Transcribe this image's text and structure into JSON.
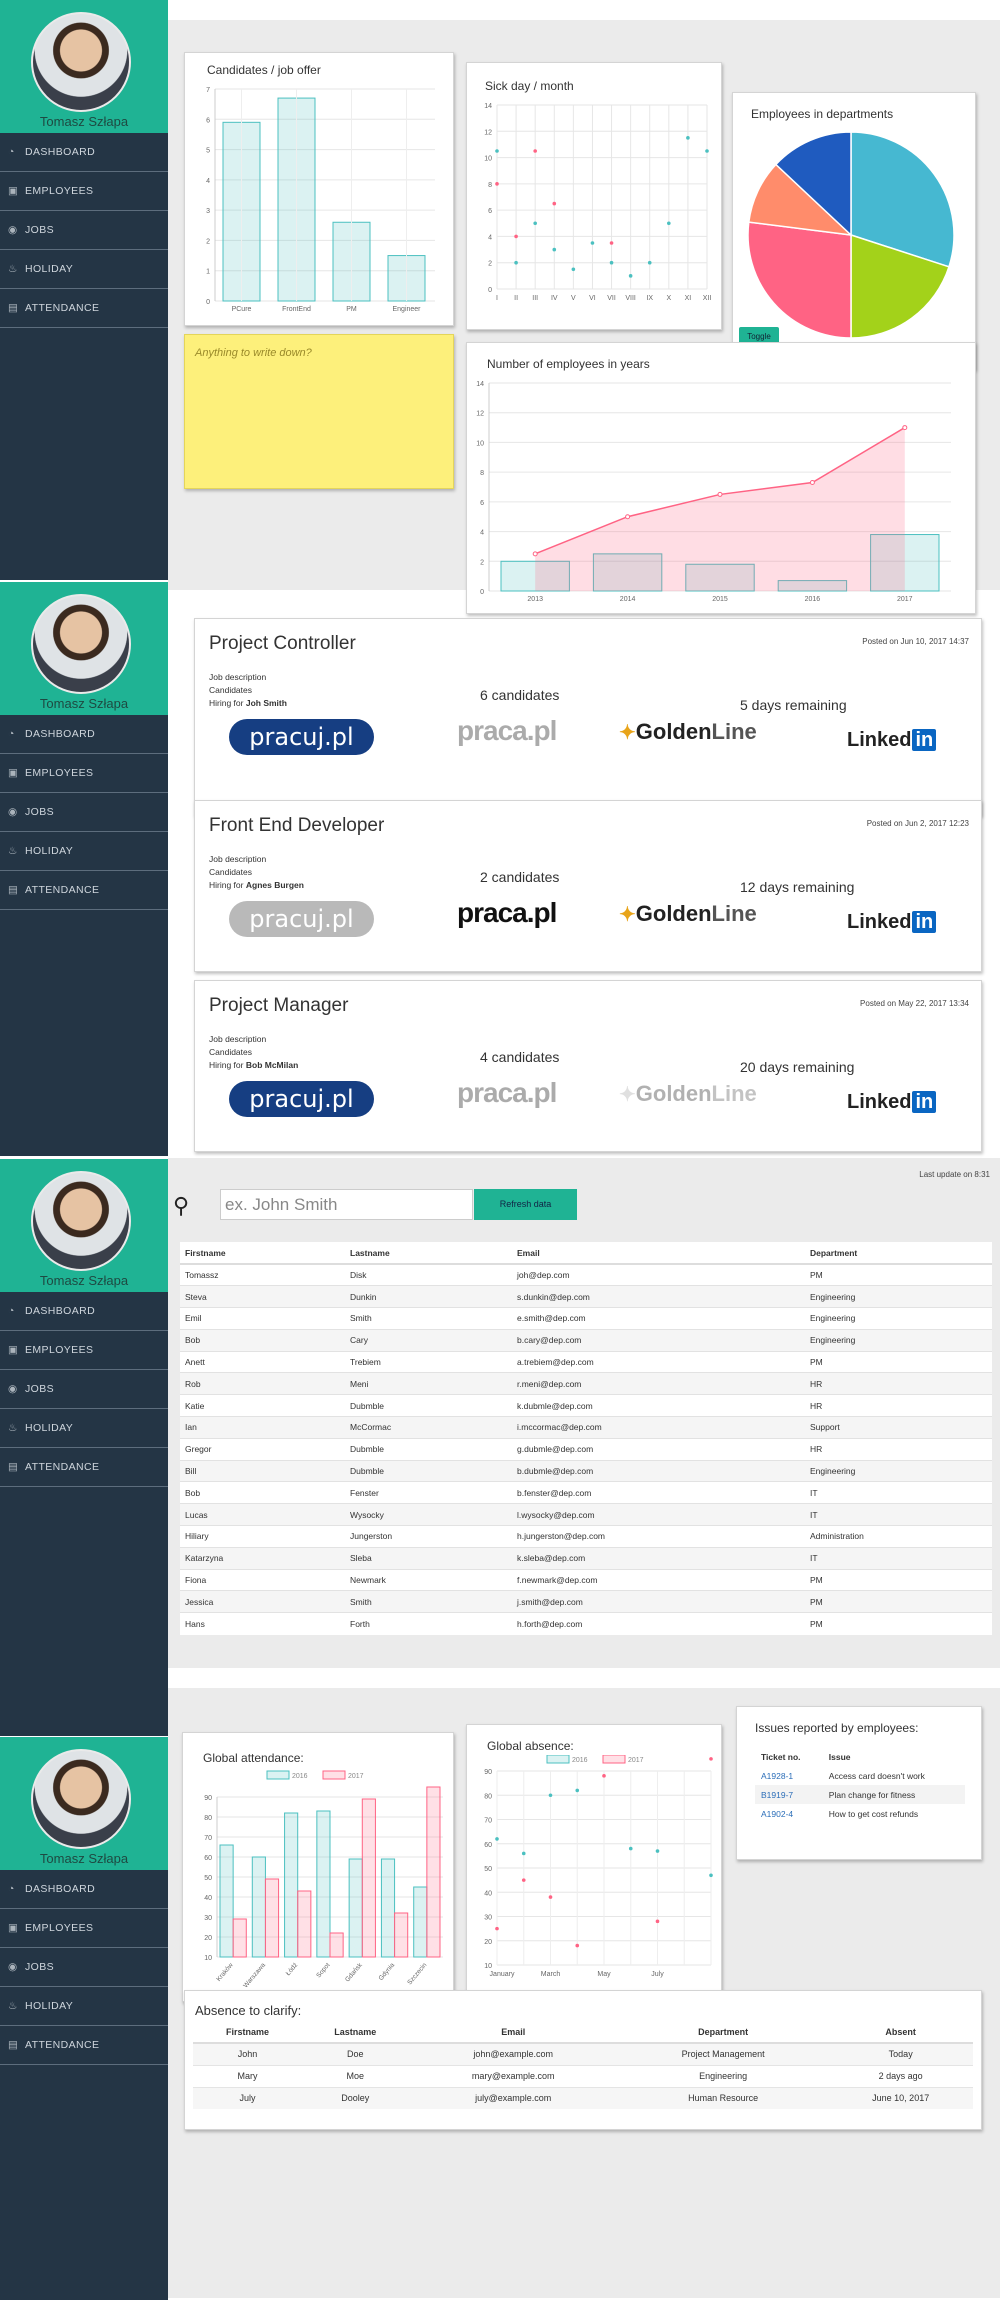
{
  "profile": {
    "name": "Tomasz Szłapa"
  },
  "nav": [
    {
      "icon": "dashboard-icon",
      "glyph": "◔",
      "label": "DASHBOARD"
    },
    {
      "icon": "employees-icon",
      "glyph": "▣",
      "label": "EMPLOYEES"
    },
    {
      "icon": "jobs-icon",
      "glyph": "◉",
      "label": "JOBS"
    },
    {
      "icon": "holiday-icon",
      "glyph": "♨",
      "label": "HOLIDAY"
    },
    {
      "icon": "attendance-icon",
      "glyph": "▤",
      "label": "ATTENDANCE"
    }
  ],
  "colors": {
    "accent": "#1fb394",
    "sidebar": "#243545",
    "pink": "#ff6384",
    "blue": "#36a2eb",
    "teal": "#4bc0c0"
  },
  "dashboard": {
    "candidates_title": "Candidates / job offer",
    "sick_title": "Sick day / month",
    "departments_title": "Employees in departments",
    "toggle_label": "Toggle",
    "sticky_placeholder": "Anything to write down?",
    "employees_years_title": "Number of employees in years"
  },
  "charts": {
    "candidates": {
      "type": "bar",
      "categories": [
        "PCure",
        "FrontEnd",
        "PM",
        "Engineer"
      ],
      "values": [
        5.9,
        6.7,
        2.6,
        1.5
      ],
      "ylim": [
        0,
        7
      ],
      "yticks": [
        0,
        1,
        2,
        3,
        4,
        5,
        6,
        7
      ],
      "color": "#4bc0c0"
    },
    "sick": {
      "type": "scatter",
      "categories": [
        "I",
        "II",
        "III",
        "IV",
        "V",
        "VI",
        "VII",
        "VIII",
        "IX",
        "X",
        "XI",
        "XII"
      ],
      "ylim": [
        0,
        14
      ],
      "yticks": [
        0,
        2,
        4,
        6,
        8,
        10,
        12,
        14
      ],
      "series": [
        {
          "color": "#ff6384",
          "values": [
            8,
            4,
            10.5,
            6.5,
            null,
            null,
            3.5,
            null,
            null,
            null,
            null,
            null
          ]
        },
        {
          "color": "#4bc0c0",
          "values": [
            10.5,
            2,
            5,
            3,
            1.5,
            3.5,
            2,
            1,
            2,
            5,
            11.5,
            10.5
          ]
        }
      ]
    },
    "departments": {
      "type": "pie",
      "values": [
        30,
        20,
        27,
        10,
        13
      ],
      "colors": [
        "#46b8d1",
        "#a3d21a",
        "#ff6384",
        "#ff8c6b",
        "#1f5bbf"
      ]
    },
    "years": {
      "type": "bar+area",
      "categories": [
        "2013",
        "2014",
        "2015",
        "2016",
        "2017"
      ],
      "bars": [
        2,
        2.5,
        1.8,
        0.7,
        3.8
      ],
      "line": [
        2.5,
        5,
        6.5,
        7.3,
        11
      ],
      "ylim": [
        0,
        14
      ],
      "yticks": [
        0,
        2,
        4,
        6,
        8,
        10,
        12,
        14
      ]
    }
  },
  "jobs": [
    {
      "title": "Project Controller",
      "desc1": "Job description",
      "desc2": "Candidates",
      "hiring_prefix": "Hiring for",
      "hiring": "Joh Smith",
      "posted": "Posted on Jun 10, 2017 14:37",
      "candidates": "6 candidates",
      "remaining": "5 days remaining",
      "active": [
        true,
        false,
        true,
        true
      ]
    },
    {
      "title": "Front End Developer",
      "desc1": "Job description",
      "desc2": "Candidates",
      "hiring_prefix": "Hiring for",
      "hiring": "Agnes Burgen",
      "posted": "Posted on Jun 2, 2017 12:23",
      "candidates": "2 candidates",
      "remaining": "12 days remaining",
      "active": [
        false,
        true,
        true,
        true
      ]
    },
    {
      "title": "Project Manager",
      "desc1": "Job description",
      "desc2": "Candidates",
      "hiring_prefix": "Hiring for",
      "hiring": "Bob McMilan",
      "posted": "Posted on May 22, 2017 13:34",
      "candidates": "4 candidates",
      "remaining": "20 days remaining",
      "active": [
        true,
        false,
        false,
        true
      ]
    }
  ],
  "logos": {
    "pracuj": "pracuj.pl",
    "praca1": "praca",
    "praca2": ".pl",
    "golden1": "Golden",
    "golden2": "Line",
    "linkedin1": "Linked",
    "linkedin2": "in"
  },
  "employees": {
    "search_placeholder": "ex. John Smith",
    "refresh_label": "Refresh data",
    "last_update": "Last update on 8:31",
    "headers": [
      "Firstname",
      "Lastname",
      "Email",
      "Department"
    ],
    "rows": [
      [
        "Tomassz",
        "Disk",
        "joh@dep.com",
        "PM"
      ],
      [
        "Steva",
        "Dunkin",
        "s.dunkin@dep.com",
        "Engineering"
      ],
      [
        "Emil",
        "Smith",
        "e.smith@dep.com",
        "Engineering"
      ],
      [
        "Bob",
        "Cary",
        "b.cary@dep.com",
        "Engineering"
      ],
      [
        "Anett",
        "Trebiem",
        "a.trebiem@dep.com",
        "PM"
      ],
      [
        "Rob",
        "Meni",
        "r.meni@dep.com",
        "HR"
      ],
      [
        "Katie",
        "Dubmble",
        "k.dubmle@dep.com",
        "HR"
      ],
      [
        "Ian",
        "McCormac",
        "i.mccormac@dep.com",
        "Support"
      ],
      [
        "Gregor",
        "Dubmble",
        "g.dubmle@dep.com",
        "HR"
      ],
      [
        "Bill",
        "Dubmble",
        "b.dubmle@dep.com",
        "Engineering"
      ],
      [
        "Bob",
        "Fenster",
        "b.fenster@dep.com",
        "IT"
      ],
      [
        "Lucas",
        "Wysocky",
        "l.wysocky@dep.com",
        "IT"
      ],
      [
        "Hiliary",
        "Jungerston",
        "h.jungerston@dep.com",
        "Administration"
      ],
      [
        "Katarzyna",
        "Sleba",
        "k.sleba@dep.com",
        "IT"
      ],
      [
        "Fiona",
        "Newmark",
        "f.newmark@dep.com",
        "PM"
      ],
      [
        "Jessica",
        "Smith",
        "j.smith@dep.com",
        "PM"
      ],
      [
        "Hans",
        "Forth",
        "h.forth@dep.com",
        "PM"
      ]
    ]
  },
  "attendance": {
    "global_attendance_title": "Global attendance:",
    "global_absence_title": "Global absence:",
    "issues_title": "Issues reported by employees:",
    "legend": [
      "2016",
      "2017"
    ],
    "att_chart": {
      "type": "bar",
      "categories": [
        "Kraków",
        "Warszawa",
        "Łódź",
        "Sopot",
        "Gdańsk",
        "Gdynia",
        "Szczecin"
      ],
      "series": [
        {
          "name": "2016",
          "values": [
            66,
            60,
            82,
            83,
            59,
            59,
            45
          ]
        },
        {
          "name": "2017",
          "values": [
            29,
            49,
            43,
            22,
            89,
            32,
            95
          ]
        }
      ],
      "ylim": [
        10,
        90
      ],
      "yticks": [
        10,
        20,
        30,
        40,
        50,
        60,
        70,
        80,
        90
      ]
    },
    "abs_chart": {
      "type": "scatter",
      "xlabels": [
        "January",
        "March",
        "May",
        "July"
      ],
      "ylim": [
        10,
        90
      ],
      "yticks": [
        10,
        20,
        30,
        40,
        50,
        60,
        70,
        80,
        90
      ],
      "series": [
        {
          "name": "2016",
          "points": [
            [
              0,
              62
            ],
            [
              1,
              56
            ],
            [
              2,
              80
            ],
            [
              3,
              82
            ],
            [
              5,
              58
            ],
            [
              6,
              57
            ],
            [
              8,
              47
            ]
          ]
        },
        {
          "name": "2017",
          "points": [
            [
              0,
              25
            ],
            [
              1,
              45
            ],
            [
              2,
              38
            ],
            [
              3,
              18
            ],
            [
              4,
              88
            ],
            [
              6,
              28
            ],
            [
              8,
              95
            ]
          ]
        }
      ]
    },
    "issues_headers": [
      "Ticket no.",
      "Issue"
    ],
    "issues": [
      [
        "A1928-1",
        "Access card doesn't work"
      ],
      [
        "B1919-7",
        "Plan change for fitness"
      ],
      [
        "A1902-4",
        "How to get cost refunds"
      ]
    ],
    "absence_title": "Absence to clarify:",
    "absence_headers": [
      "Firstname",
      "Lastname",
      "Email",
      "Department",
      "Absent"
    ],
    "absence_rows": [
      [
        "John",
        "Doe",
        "john@example.com",
        "Project Management",
        "Today"
      ],
      [
        "Mary",
        "Moe",
        "mary@example.com",
        "Engineering",
        "2 days ago"
      ],
      [
        "July",
        "Dooley",
        "july@example.com",
        "Human Resource",
        "June 10, 2017"
      ]
    ]
  }
}
